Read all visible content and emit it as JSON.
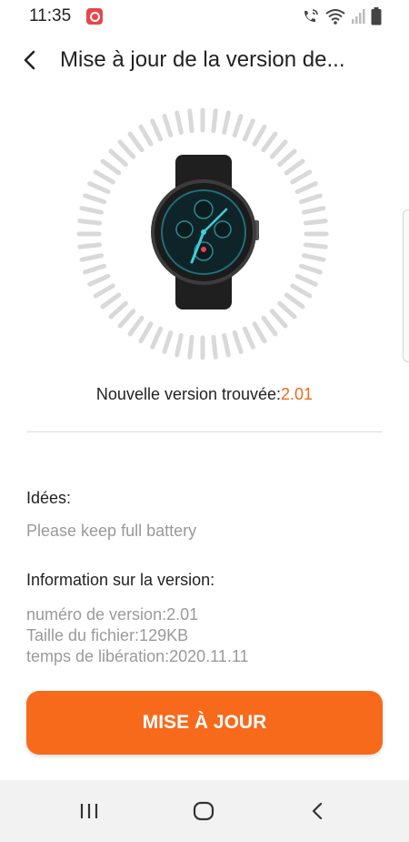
{
  "status_bar": {
    "time": "11:35",
    "icons": [
      "notification-icon",
      "wifi-calling-icon",
      "wifi-icon",
      "signal-icon",
      "battery-icon"
    ]
  },
  "header": {
    "title": "Mise à jour de la version de..."
  },
  "firmware": {
    "found_label": "Nouvelle version trouvée:",
    "found_value": "2.01"
  },
  "tips": {
    "label": "Idées:",
    "text": "Please keep full battery"
  },
  "version_info": {
    "label": "Information sur la version:",
    "number": "numéro de version:2.01",
    "size": "Taille du fichier:129KB",
    "release": "temps de libération:2020.11.11"
  },
  "actions": {
    "update_label": "MISE À JOUR"
  },
  "colors": {
    "accent": "#f76a1b",
    "text": "#222222",
    "muted": "#9a9a9a"
  }
}
